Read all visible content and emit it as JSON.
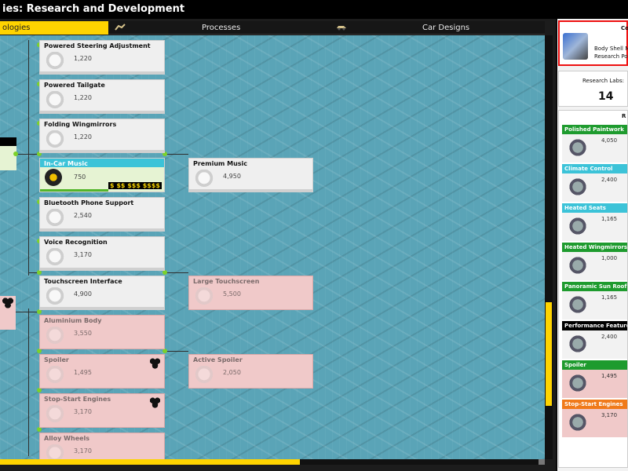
{
  "window": {
    "title": "ies: Research and Development"
  },
  "tabs": [
    {
      "label": "ologies"
    },
    {
      "label": "Processes",
      "icon": "robot-arm-icon"
    },
    {
      "label": "Car Designs",
      "icon": "car-icon"
    }
  ],
  "tree": {
    "cards": [
      {
        "name": "Powered Steering Adjustment",
        "cost": "1,220",
        "state": "available"
      },
      {
        "name": "Powered Tailgate",
        "cost": "1,220",
        "state": "available"
      },
      {
        "name": "Folding Wingmirrors",
        "cost": "1,220",
        "state": "available"
      },
      {
        "name": "In-Car Music",
        "cost": "750",
        "state": "researching",
        "money": "$ $$ $$$ $$$$"
      },
      {
        "name": "Bluetooth Phone Support",
        "cost": "2,540",
        "state": "available"
      },
      {
        "name": "Voice Recognition",
        "cost": "3,170",
        "state": "available"
      },
      {
        "name": "Touchscreen Interface",
        "cost": "4,900",
        "state": "available"
      },
      {
        "name": "Aluminium Body",
        "cost": "3,550",
        "state": "locked"
      },
      {
        "name": "Spoiler",
        "cost": "1,495",
        "state": "locked"
      },
      {
        "name": "Stop-Start Engines",
        "cost": "3,170",
        "state": "locked"
      },
      {
        "name": "Alloy Wheels",
        "cost": "3,170",
        "state": "locked"
      },
      {
        "name": "Premium Music",
        "cost": "4,950",
        "state": "available"
      },
      {
        "name": "Large Touchscreen",
        "cost": "5,500",
        "state": "locked"
      },
      {
        "name": "Active Spoiler",
        "cost": "2,050",
        "state": "locked"
      }
    ]
  },
  "scroll": {
    "horizontal_position": 0.55,
    "vertical_position": 0.63
  },
  "side": {
    "component": {
      "title": "Co",
      "line1": "Body Shell M",
      "line2": "Research Po"
    },
    "labs": {
      "label": "Research Labs:",
      "value": "14"
    },
    "queue_title": "R",
    "queue": [
      {
        "name": "Polished Paintwork",
        "cost": "4,050",
        "header_color": "#1e9b2e",
        "state": "available"
      },
      {
        "name": "Climate Control",
        "cost": "2,400",
        "header_color": "#3cc3d8",
        "state": "available"
      },
      {
        "name": "Heated Seats",
        "cost": "1,165",
        "header_color": "#3cc3d8",
        "state": "available"
      },
      {
        "name": "Heated Wingmirrors",
        "cost": "1,000",
        "header_color": "#1e9b2e",
        "state": "available"
      },
      {
        "name": "Panoramic Sun Roof",
        "cost": "1,165",
        "header_color": "#1e9b2e",
        "state": "available"
      },
      {
        "name": "Performance Feature",
        "cost": "2,400",
        "header_color": "#000000",
        "state": "available"
      },
      {
        "name": "Spoiler",
        "cost": "1,495",
        "header_color": "#1e9b2e",
        "state": "locked"
      },
      {
        "name": "Stop-Start Engines",
        "cost": "3,170",
        "header_color": "#f07a1a",
        "state": "locked"
      }
    ]
  }
}
